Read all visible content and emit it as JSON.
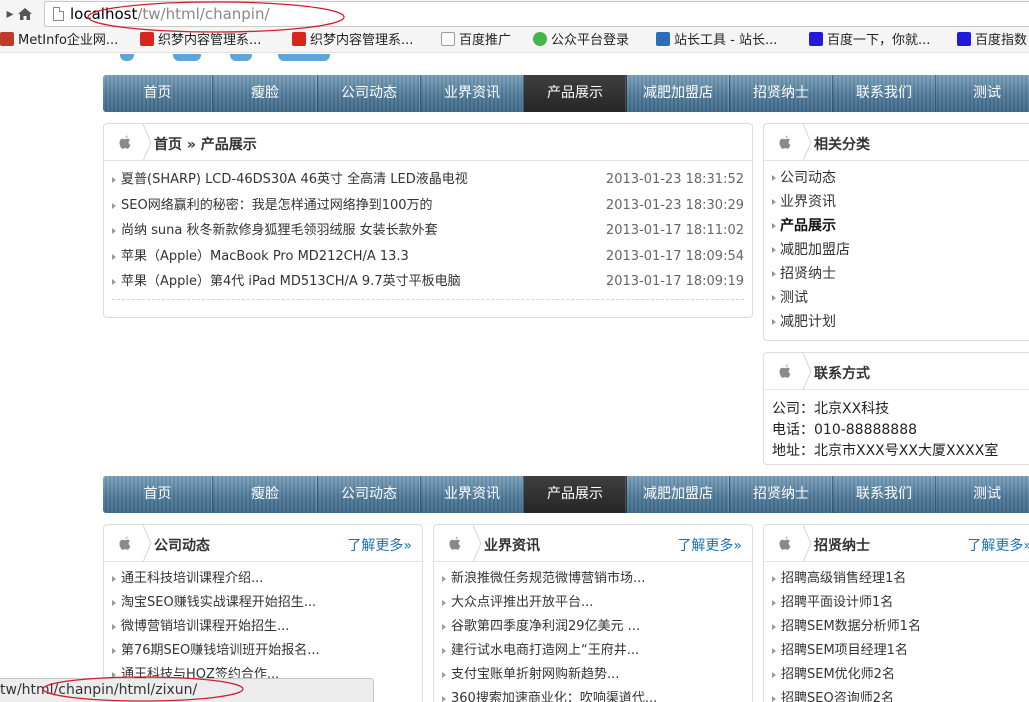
{
  "browser": {
    "url_host": "localhost",
    "url_path": "/tw/html/chanpin/",
    "bookmarks": [
      {
        "label": "MetInfo企业网...",
        "icon": "metinfo-icon",
        "color": "#c0392b"
      },
      {
        "label": "织梦内容管理系...",
        "icon": "dedecms-icon",
        "color": "#d9261c"
      },
      {
        "label": "织梦内容管理系...",
        "icon": "dedecms-icon",
        "color": "#d9261c"
      },
      {
        "label": "百度推广",
        "icon": "page-icon",
        "color": "#999999"
      },
      {
        "label": "公众平台登录",
        "icon": "wechat-icon",
        "color": "#44b549"
      },
      {
        "label": "站长工具 - 站长...",
        "icon": "chinaz-icon",
        "color": "#2a6ebb"
      },
      {
        "label": "百度一下，你就...",
        "icon": "baidu-icon",
        "color": "#2319dc"
      },
      {
        "label": "百度指数",
        "icon": "baidu-icon",
        "color": "#2319dc"
      }
    ],
    "status_url": "tw/html/chanpin/html/zixun/"
  },
  "nav": {
    "items": [
      "首页",
      "瘦脸",
      "公司动态",
      "业界资讯",
      "产品展示",
      "减肥加盟店",
      "招贤纳士",
      "联系我们",
      "测试"
    ],
    "active_index": 4
  },
  "main": {
    "breadcrumb_home": "首页",
    "breadcrumb_sep": "»",
    "breadcrumb_current": "产品展示",
    "articles": [
      {
        "title": "夏普(SHARP) LCD-46DS30A 46英寸 全高清 LED液晶电视",
        "date": "2013-01-23 18:31:52"
      },
      {
        "title": "SEO网络赢利的秘密：我是怎样通过网络挣到100万的",
        "date": "2013-01-23 18:30:29"
      },
      {
        "title": "尚纳 suna 秋冬新款修身狐狸毛领羽绒服 女装长款外套",
        "date": "2013-01-17 18:11:02"
      },
      {
        "title": "苹果（Apple）MacBook Pro MD212CH/A 13.3",
        "date": "2013-01-17 18:09:54"
      },
      {
        "title": "苹果（Apple）第4代 iPad MD513CH/A 9.7英寸平板电脑",
        "date": "2013-01-17 18:09:19"
      }
    ]
  },
  "sidebar": {
    "categories_title": "相关分类",
    "categories": [
      "公司动态",
      "业界资讯",
      "产品展示",
      "减肥加盟店",
      "招贤纳士",
      "测试",
      "减肥计划"
    ],
    "current_category": "产品展示",
    "contact_title": "联系方式",
    "contact_lines": [
      "公司：北京XX科技",
      "电话：010-88888888",
      "地址：北京市XXX号XX大厦XXXX室"
    ]
  },
  "bottom": {
    "more_label": "了解更多»",
    "boxes": [
      {
        "title": "公司动态",
        "items": [
          "通王科技培训课程介绍...",
          "淘宝SEO赚钱实战课程开始招生...",
          "微博营销培训课程开始招生...",
          "第76期SEO赚钱培训班开始报名...",
          "通王科技与HOZ签约合作..."
        ]
      },
      {
        "title": "业界资讯",
        "items": [
          "新浪推微任务规范微博营销市场...",
          "大众点评推出开放平台...",
          "谷歌第四季度净利润29亿美元 ...",
          "建行试水电商打造网上“王府井...",
          "支付宝账单折射网购新趋势...",
          "360搜索加速商业化：吹响渠道代..."
        ]
      },
      {
        "title": "招贤纳士",
        "items": [
          "招聘高级销售经理1名",
          "招聘平面设计师1名",
          "招聘SEM数据分析师1名",
          "招聘SEM项目经理1名",
          "招聘SEM优化师2名",
          "招聘SEO咨询师2名"
        ]
      }
    ]
  },
  "colors": {
    "annotation": "#d0202a",
    "link": "#1a73b8",
    "nav": "#4f7a99"
  }
}
